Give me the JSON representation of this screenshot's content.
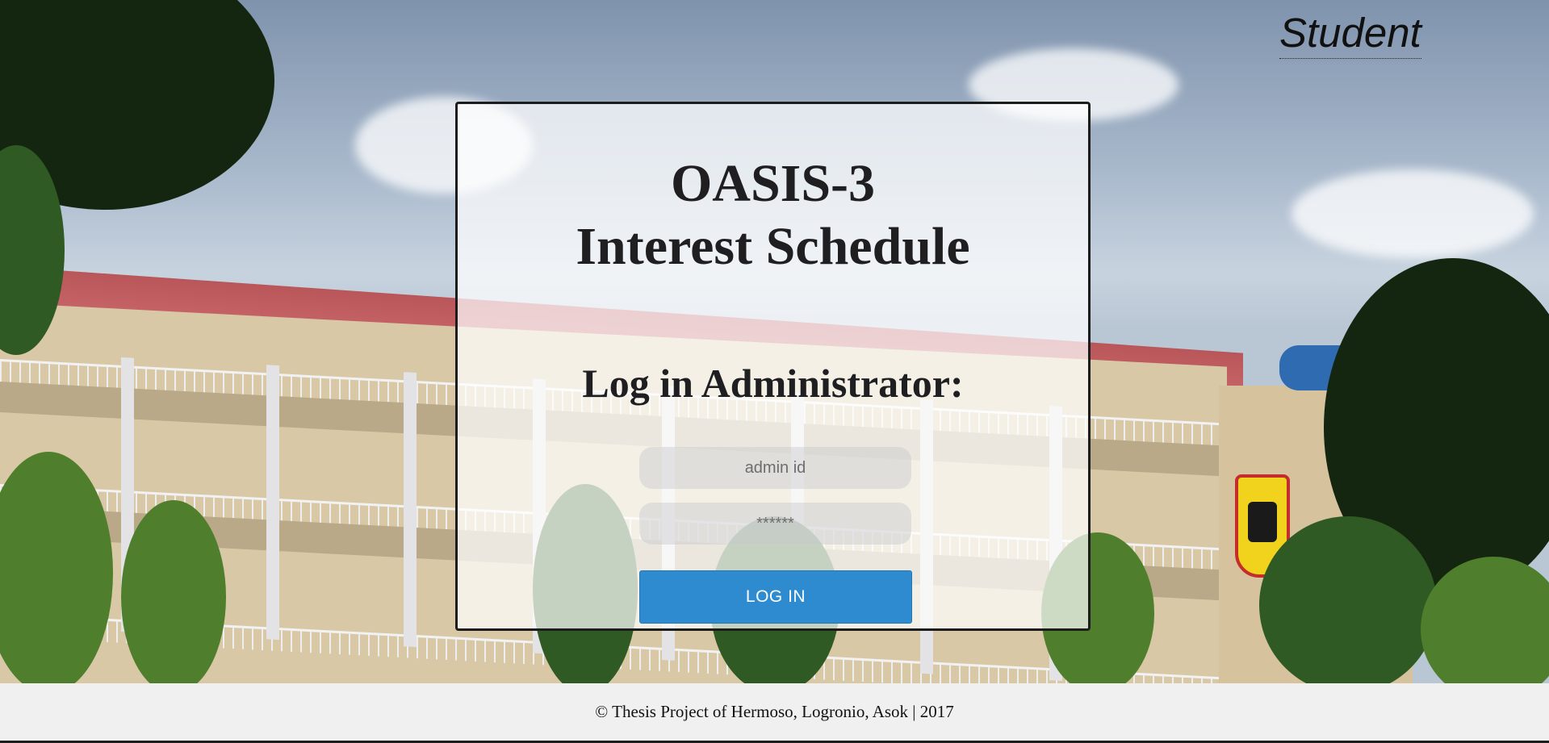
{
  "nav": {
    "student_link": "Student"
  },
  "login": {
    "title_line1": "OASIS-3",
    "title_line2": "Interest Schedule",
    "subtitle": "Log in Administrator:",
    "admin_id_placeholder": "admin id",
    "password_placeholder": "******",
    "login_button": "LOG IN"
  },
  "footer": {
    "text": "© Thesis Project of Hermoso, Logronio, Asok | 2017"
  },
  "colors": {
    "button": "#2e8bd0",
    "footer_bg": "#f0f0f0"
  }
}
